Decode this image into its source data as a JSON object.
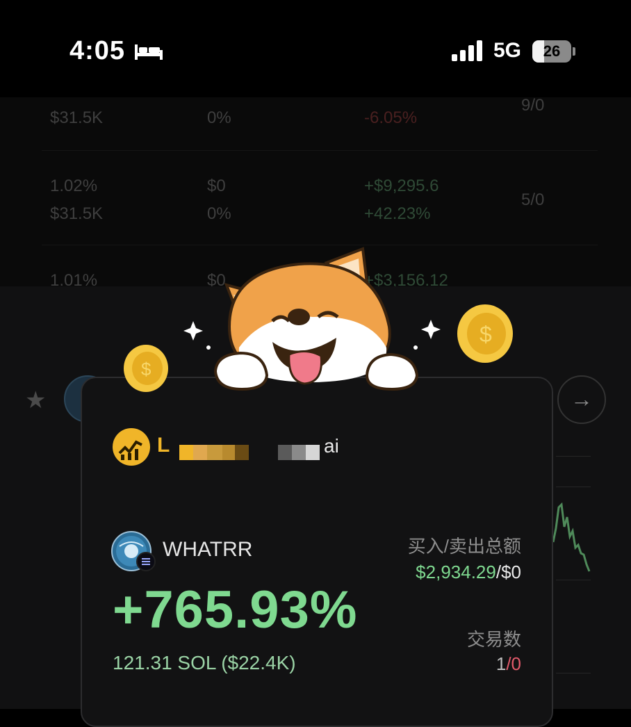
{
  "status_bar": {
    "time": "4:05",
    "network": "5G",
    "battery": "26"
  },
  "background_table": {
    "rows": [
      {
        "col1a": "",
        "col1b": "$31.5K",
        "col2a": "",
        "col2b": "0%",
        "col3a": "",
        "col3b": "-6.05%",
        "col4": "9/0"
      },
      {
        "col1a": "1.02%",
        "col1b": "$31.5K",
        "col2a": "$0",
        "col2b": "0%",
        "col3a": "+$9,295.6",
        "col3b": "+42.23%",
        "col4": "5/0"
      },
      {
        "col1a": "1.01%",
        "col1b": "",
        "col2a": "$0",
        "col2b": "",
        "col3a": "+$3,156.12",
        "col3b": "",
        "col4": ""
      }
    ]
  },
  "card": {
    "user_handle_start": "L",
    "user_handle_end": "ai",
    "token_name": "WHATRR",
    "pnl_percent": "+765.93%",
    "sol_amount": "121.31 SOL ($22.4K)",
    "buy_sell_label": "买入/卖出总额",
    "buy_amount": "$2,934.29",
    "sell_amount": "/$0",
    "trades_label": "交易数",
    "trades_buy": "1",
    "trades_sell": "/0"
  },
  "colors": {
    "profit_green": "#7fd990",
    "loss_red": "#e25a6b",
    "accent_gold": "#f0b529"
  }
}
